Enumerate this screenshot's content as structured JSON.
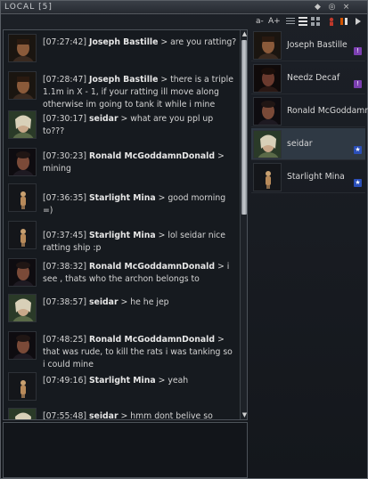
{
  "window": {
    "title": "LOCAL [5]",
    "buttons": [
      "◆",
      "◎",
      "×"
    ]
  },
  "toolbar": {
    "font_smaller": "a-",
    "font_larger": "A+"
  },
  "messages": [
    {
      "time": "[07:27:42]",
      "author": "Joseph Bastille",
      "text": " > are you ratting?",
      "portrait": "joseph"
    },
    {
      "time": "[07:28:47]",
      "author": "Joseph Bastille",
      "text": " > there is a triple 1.1m in X - 1, if your ratting ill move along otherwise im going to tank it while i mine",
      "portrait": "joseph"
    },
    {
      "time": "[07:30:17]",
      "author": "seidar",
      "text": " > what are you ppl up to???",
      "portrait": "seidar"
    },
    {
      "time": "[07:30:23]",
      "author": "Ronald McGoddamnDonald",
      "text": " > mining",
      "portrait": "ronald"
    },
    {
      "time": "[07:36:35]",
      "author": "Starlight Mina",
      "text": " > good morning =)",
      "portrait": "starlight"
    },
    {
      "time": "[07:37:45]",
      "author": "Starlight Mina",
      "text": " > lol seidar nice ratting ship :p",
      "portrait": "starlight"
    },
    {
      "time": "[07:38:32]",
      "author": "Ronald McGoddamnDonald",
      "text": " > i see , thats who the archon belongs to",
      "portrait": "ronald"
    },
    {
      "time": "[07:38:57]",
      "author": "seidar",
      "text": " > he he jep",
      "portrait": "seidar"
    },
    {
      "time": "[07:48:25]",
      "author": "Ronald McGoddamnDonald",
      "text": " > that was rude, to kill the rats i was tanking so i could mine",
      "portrait": "ronald"
    },
    {
      "time": "[07:49:16]",
      "author": "Starlight Mina",
      "text": " > yeah",
      "portrait": "starlight"
    },
    {
      "time": "[07:55:48]",
      "author": "seidar",
      "text": " > hmm dont belive so",
      "portrait": "seidar"
    }
  ],
  "members": [
    {
      "name": "Joseph Bastille",
      "portrait": "joseph",
      "badge": "purple",
      "badge_glyph": "!"
    },
    {
      "name": "Needz Decaf",
      "portrait": "needz",
      "badge": "purple",
      "badge_glyph": "!"
    },
    {
      "name": "Ronald McGoddamn",
      "portrait": "ronald",
      "badge": "",
      "badge_glyph": ""
    },
    {
      "name": "seidar",
      "portrait": "seidar",
      "badge": "star",
      "badge_glyph": "★"
    },
    {
      "name": "Starlight Mina",
      "portrait": "starlight",
      "badge": "star",
      "badge_glyph": "★"
    }
  ],
  "colors": {
    "badge_purple": "#7b3fb0",
    "badge_star": "#2b4fb8",
    "selected_row": "#2f3944"
  }
}
